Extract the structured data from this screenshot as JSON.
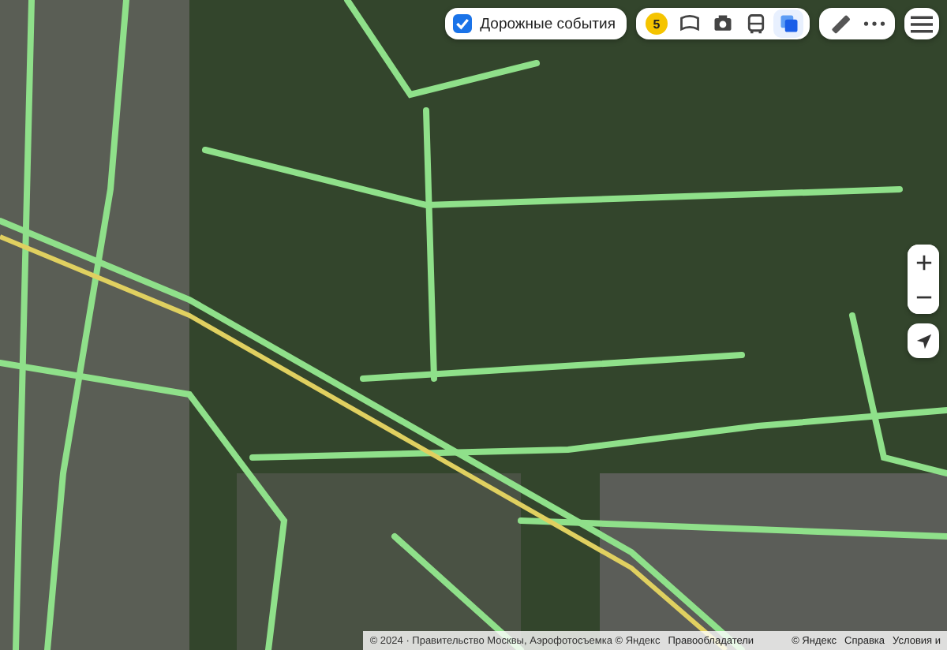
{
  "traffic_toggle": {
    "label": "Дорожные события",
    "checked": true
  },
  "layer_tools": [
    {
      "kind": "traffic",
      "text": "5",
      "selected": false
    },
    {
      "kind": "panorama",
      "selected": false
    },
    {
      "kind": "camera",
      "selected": false
    },
    {
      "kind": "bus",
      "selected": false
    },
    {
      "kind": "layers",
      "selected": true
    }
  ],
  "attribution": {
    "copyright": "© 2024 · Правительство Москвы, Аэрофотосъемка © Яндекс",
    "links": [
      "Правообладатели"
    ],
    "right_links": [
      "© Яндекс",
      "Справка",
      "Условия и"
    ]
  }
}
